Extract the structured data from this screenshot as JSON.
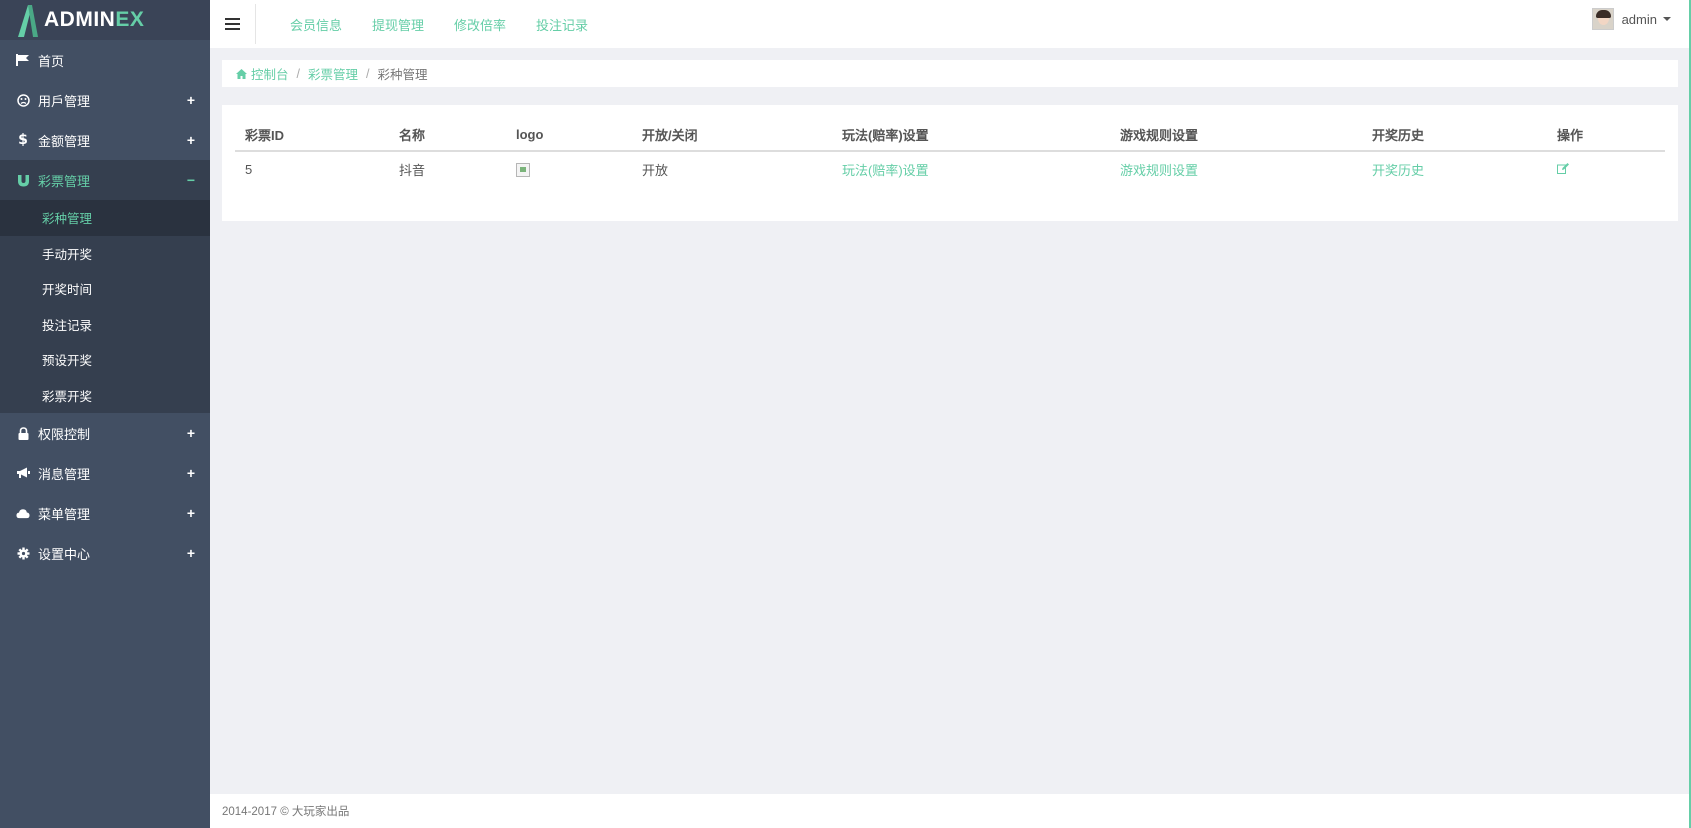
{
  "app": {
    "logo_text_main": "ADMIN",
    "logo_text_accent": "EX",
    "accent_color": "#65cea7",
    "sidebar_color": "#424f63"
  },
  "sidebar": {
    "items": [
      {
        "label": "首页",
        "icon": "flag-icon",
        "sign": ""
      },
      {
        "label": "用戶管理",
        "icon": "user-face-icon",
        "sign": "+"
      },
      {
        "label": "金额管理",
        "icon": "dollar-icon",
        "sign": "+"
      },
      {
        "label": "彩票管理",
        "icon": "magnet-icon",
        "sign": "−"
      },
      {
        "label": "权限控制",
        "icon": "lock-icon",
        "sign": "+"
      },
      {
        "label": "消息管理",
        "icon": "bullhorn-icon",
        "sign": "+"
      },
      {
        "label": "菜单管理",
        "icon": "cloud-icon",
        "sign": "+"
      },
      {
        "label": "设置中心",
        "icon": "gear-icon",
        "sign": "+"
      }
    ],
    "submenu": [
      {
        "label": "彩种管理"
      },
      {
        "label": "手动开奖"
      },
      {
        "label": "开奖时间"
      },
      {
        "label": "投注记录"
      },
      {
        "label": "预设开奖"
      },
      {
        "label": "彩票开奖"
      }
    ]
  },
  "header": {
    "nav": [
      "会员信息",
      "提现管理",
      "修改倍率",
      "投注记录"
    ],
    "user_name": "admin"
  },
  "breadcrumb": {
    "items": [
      "控制台",
      "彩票管理"
    ],
    "current": "彩种管理"
  },
  "table": {
    "headers": [
      "彩票ID",
      "名称",
      "logo",
      "开放/关闭",
      "玩法(赔率)设置",
      "游戏规则设置",
      "开奖历史",
      "操作"
    ],
    "rows": [
      {
        "id": "5",
        "name": "抖音",
        "status": "开放",
        "odds_link": "玩法(赔率)设置",
        "rules_link": "游戏规则设置",
        "history_link": "开奖历史",
        "action_icon": "edit-icon"
      }
    ]
  },
  "footer": {
    "text": "2014-2017 © 大玩家出品"
  }
}
